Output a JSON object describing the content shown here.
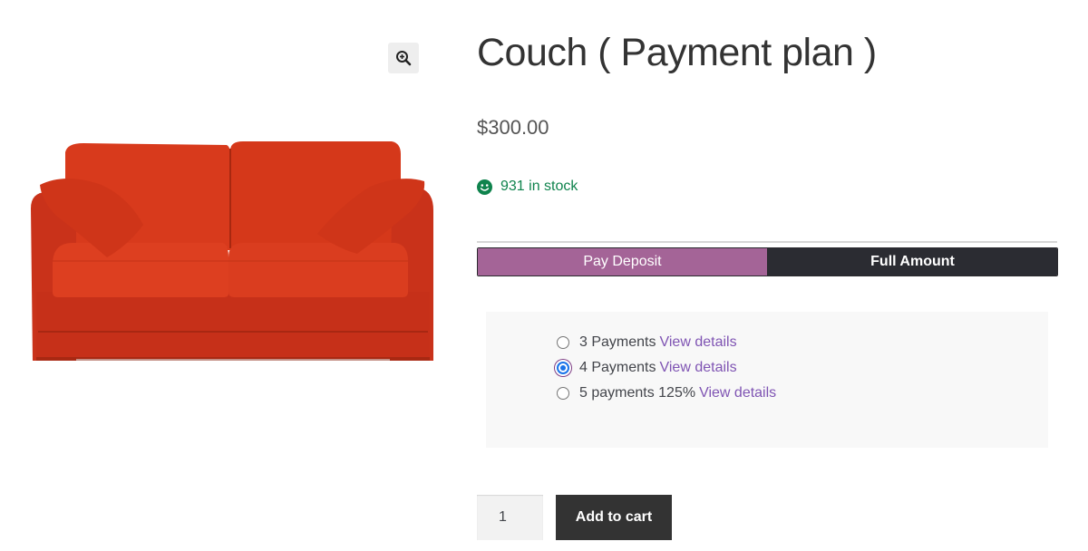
{
  "gallery": {
    "zoom_icon": "zoom-in-icon",
    "image_alt": "Red couch"
  },
  "product": {
    "title": "Couch ( Payment plan )",
    "price": "$300.00",
    "stock_text": "931 in stock",
    "stock_icon": "smile-icon",
    "stock_color": "#0f834d"
  },
  "deposit_toggle": {
    "deposit_label": "Pay Deposit",
    "full_label": "Full Amount",
    "deposit_color": "#a46497",
    "full_color": "#2b2c32"
  },
  "plans": [
    {
      "label": "3 Payments",
      "link": "View details",
      "checked": false
    },
    {
      "label": "4 Payments",
      "link": "View details",
      "checked": true
    },
    {
      "label": "5 payments 125%",
      "link": "View details",
      "checked": false
    }
  ],
  "cart": {
    "quantity": "1",
    "button_label": "Add to cart"
  }
}
